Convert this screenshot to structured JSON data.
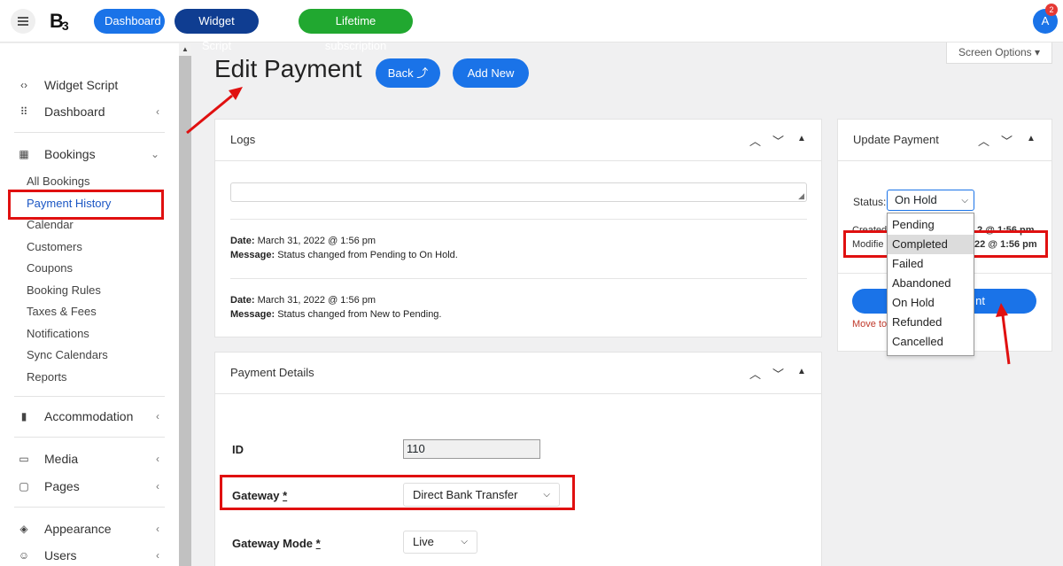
{
  "topbar": {
    "logo": "B",
    "logo_small": "3",
    "pills": [
      "Dashboard",
      "Widget Script",
      "Lifetime subscription"
    ],
    "avatar_letter": "A",
    "notification_count": "2"
  },
  "sidebar": {
    "items": [
      {
        "label": "Widget Script",
        "icon": "code-icon"
      },
      {
        "label": "Dashboard",
        "icon": "grid-icon"
      },
      {
        "label": "Bookings",
        "icon": "calendar-icon"
      },
      {
        "label": "Accommodation",
        "icon": "building-icon"
      },
      {
        "label": "Media",
        "icon": "image-icon"
      },
      {
        "label": "Pages",
        "icon": "page-icon"
      },
      {
        "label": "Appearance",
        "icon": "paint-icon"
      },
      {
        "label": "Users",
        "icon": "users-icon"
      }
    ],
    "bookings_sub": [
      "All Bookings",
      "Payment History",
      "Calendar",
      "Customers",
      "Coupons",
      "Booking Rules",
      "Taxes & Fees",
      "Notifications",
      "Sync Calendars",
      "Reports"
    ]
  },
  "header": {
    "title": "Edit Payment",
    "back_label": "Back ⤴",
    "add_new_label": "Add New",
    "screen_options": "Screen Options ▾"
  },
  "logs": {
    "title": "Logs",
    "entries": [
      {
        "date_label": "Date:",
        "date": "March 31, 2022 @ 1:56 pm",
        "msg_label": "Message:",
        "msg": "Status changed from Pending to On Hold."
      },
      {
        "date_label": "Date:",
        "date": "March 31, 2022 @ 1:56 pm",
        "msg_label": "Message:",
        "msg": "Status changed from New to Pending."
      }
    ]
  },
  "details": {
    "title": "Payment Details",
    "id_label": "ID",
    "id_value": "110",
    "gateway_label": "Gateway",
    "gateway_value": "Direct Bank Transfer",
    "mode_label": "Gateway Mode",
    "mode_value": "Live",
    "required_mark": "*"
  },
  "update": {
    "title": "Update Payment",
    "status_label": "Status:",
    "status_value": "On Hold",
    "created_label": "Created",
    "created_value": "2 @ 1:56 pm",
    "modified_label": "Modifie",
    "modified_value": "22 @ 1:56 pm",
    "button_tail": "nt",
    "trash_label": "Move to",
    "options": [
      "Pending",
      "Completed",
      "Failed",
      "Abandoned",
      "On Hold",
      "Refunded",
      "Cancelled"
    ]
  },
  "colors": {
    "accent": "#1a73e8",
    "highlight": "#e01010",
    "lifetime": "#21a830"
  }
}
